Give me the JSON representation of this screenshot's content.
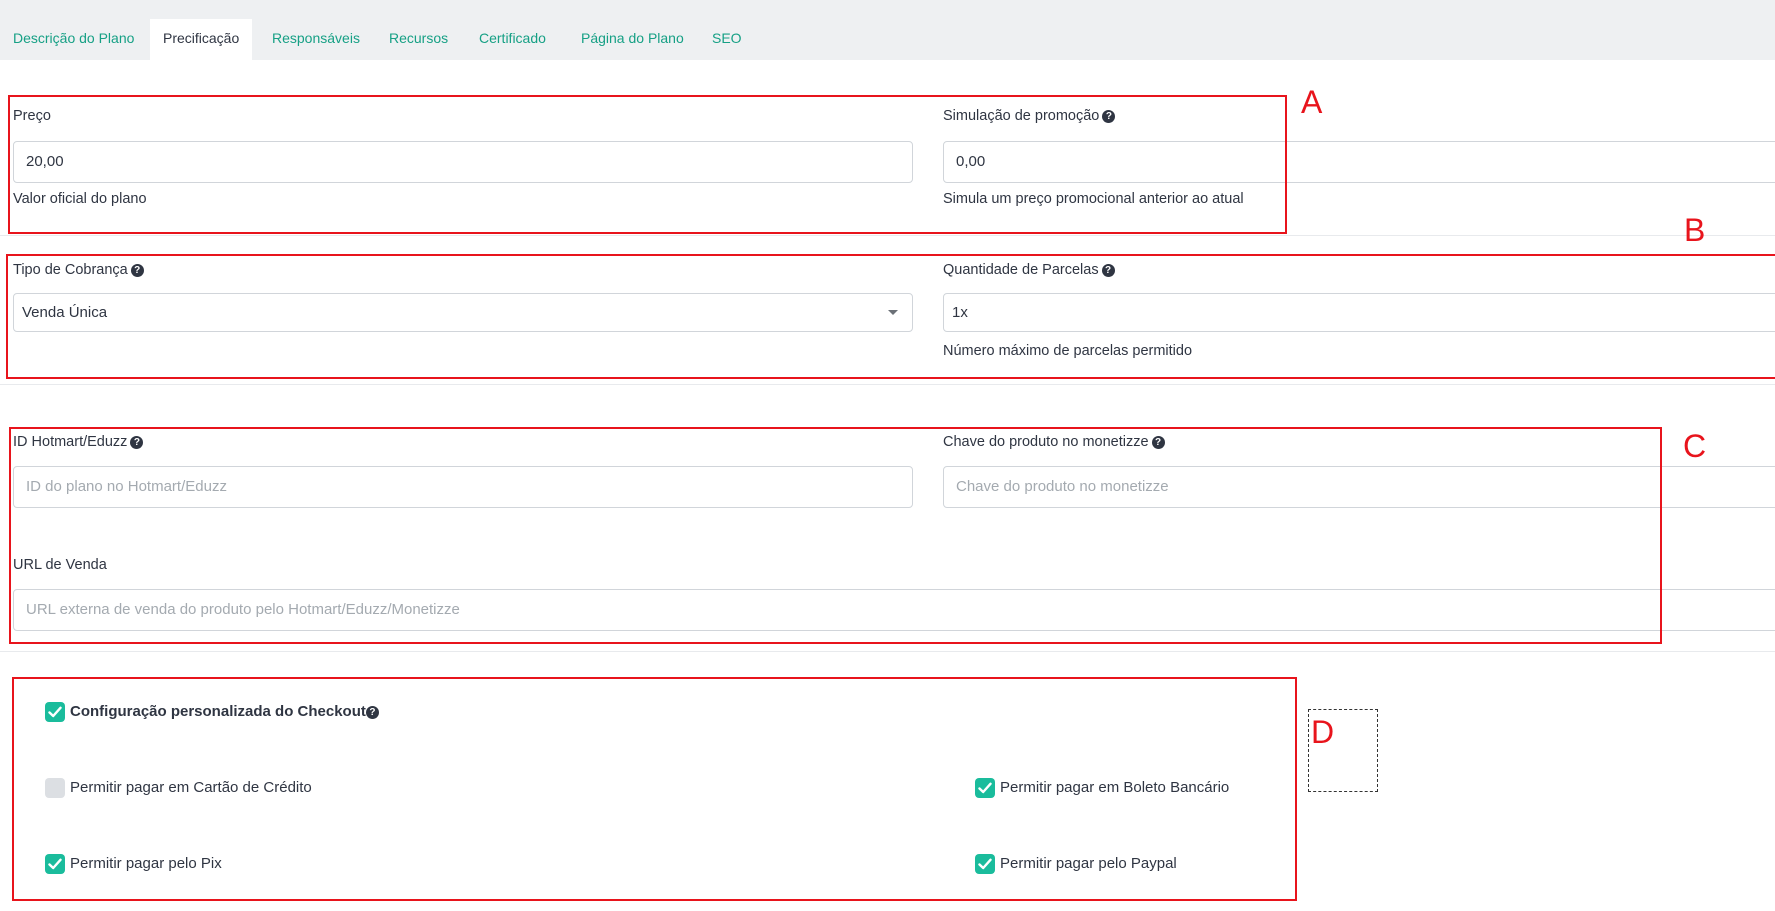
{
  "tabs": [
    {
      "label": "Descrição do Plano"
    },
    {
      "label": "Precificação"
    },
    {
      "label": "Responsáveis"
    },
    {
      "label": "Recursos"
    },
    {
      "label": "Certificado"
    },
    {
      "label": "Página do Plano"
    },
    {
      "label": "SEO"
    }
  ],
  "active_tab": "Precificação",
  "pricing": {
    "price_label": "Preço",
    "price_value": "20,00",
    "price_hint": "Valor oficial do plano",
    "promo_label": "Simulação de promoção",
    "promo_value": "0,00",
    "promo_hint": "Simula um preço promocional anterior ao atual"
  },
  "billing": {
    "type_label": "Tipo de Cobrança",
    "type_value": "Venda Única",
    "installments_label": "Quantidade de Parcelas",
    "installments_value": "1x",
    "installments_hint": "Número máximo de parcelas permitido"
  },
  "integration": {
    "hotmart_label": "ID Hotmart/Eduzz",
    "hotmart_placeholder": "ID do plano no Hotmart/Eduzz",
    "monetizze_label": "Chave do produto no monetizze",
    "monetizze_placeholder": "Chave do produto no monetizze",
    "sale_url_label": "URL de Venda",
    "sale_url_placeholder": "URL externa de venda do produto pelo Hotmart/Eduzz/Monetizze"
  },
  "checkout": {
    "custom_label": "Configuração personalizada do Checkout",
    "custom_checked": true,
    "options": [
      {
        "label": "Permitir pagar em Cartão de Crédito",
        "checked": false
      },
      {
        "label": "Permitir pagar em Boleto Bancário",
        "checked": true
      },
      {
        "label": "Permitir pagar pelo Pix",
        "checked": true
      },
      {
        "label": "Permitir pagar pelo Paypal",
        "checked": true
      }
    ]
  },
  "annotations": {
    "a": "A",
    "b": "B",
    "c": "C",
    "d": "D"
  },
  "colors": {
    "accent": "#1abc9c",
    "tab_link": "#16a085",
    "annotation_red": "#e8141c"
  }
}
